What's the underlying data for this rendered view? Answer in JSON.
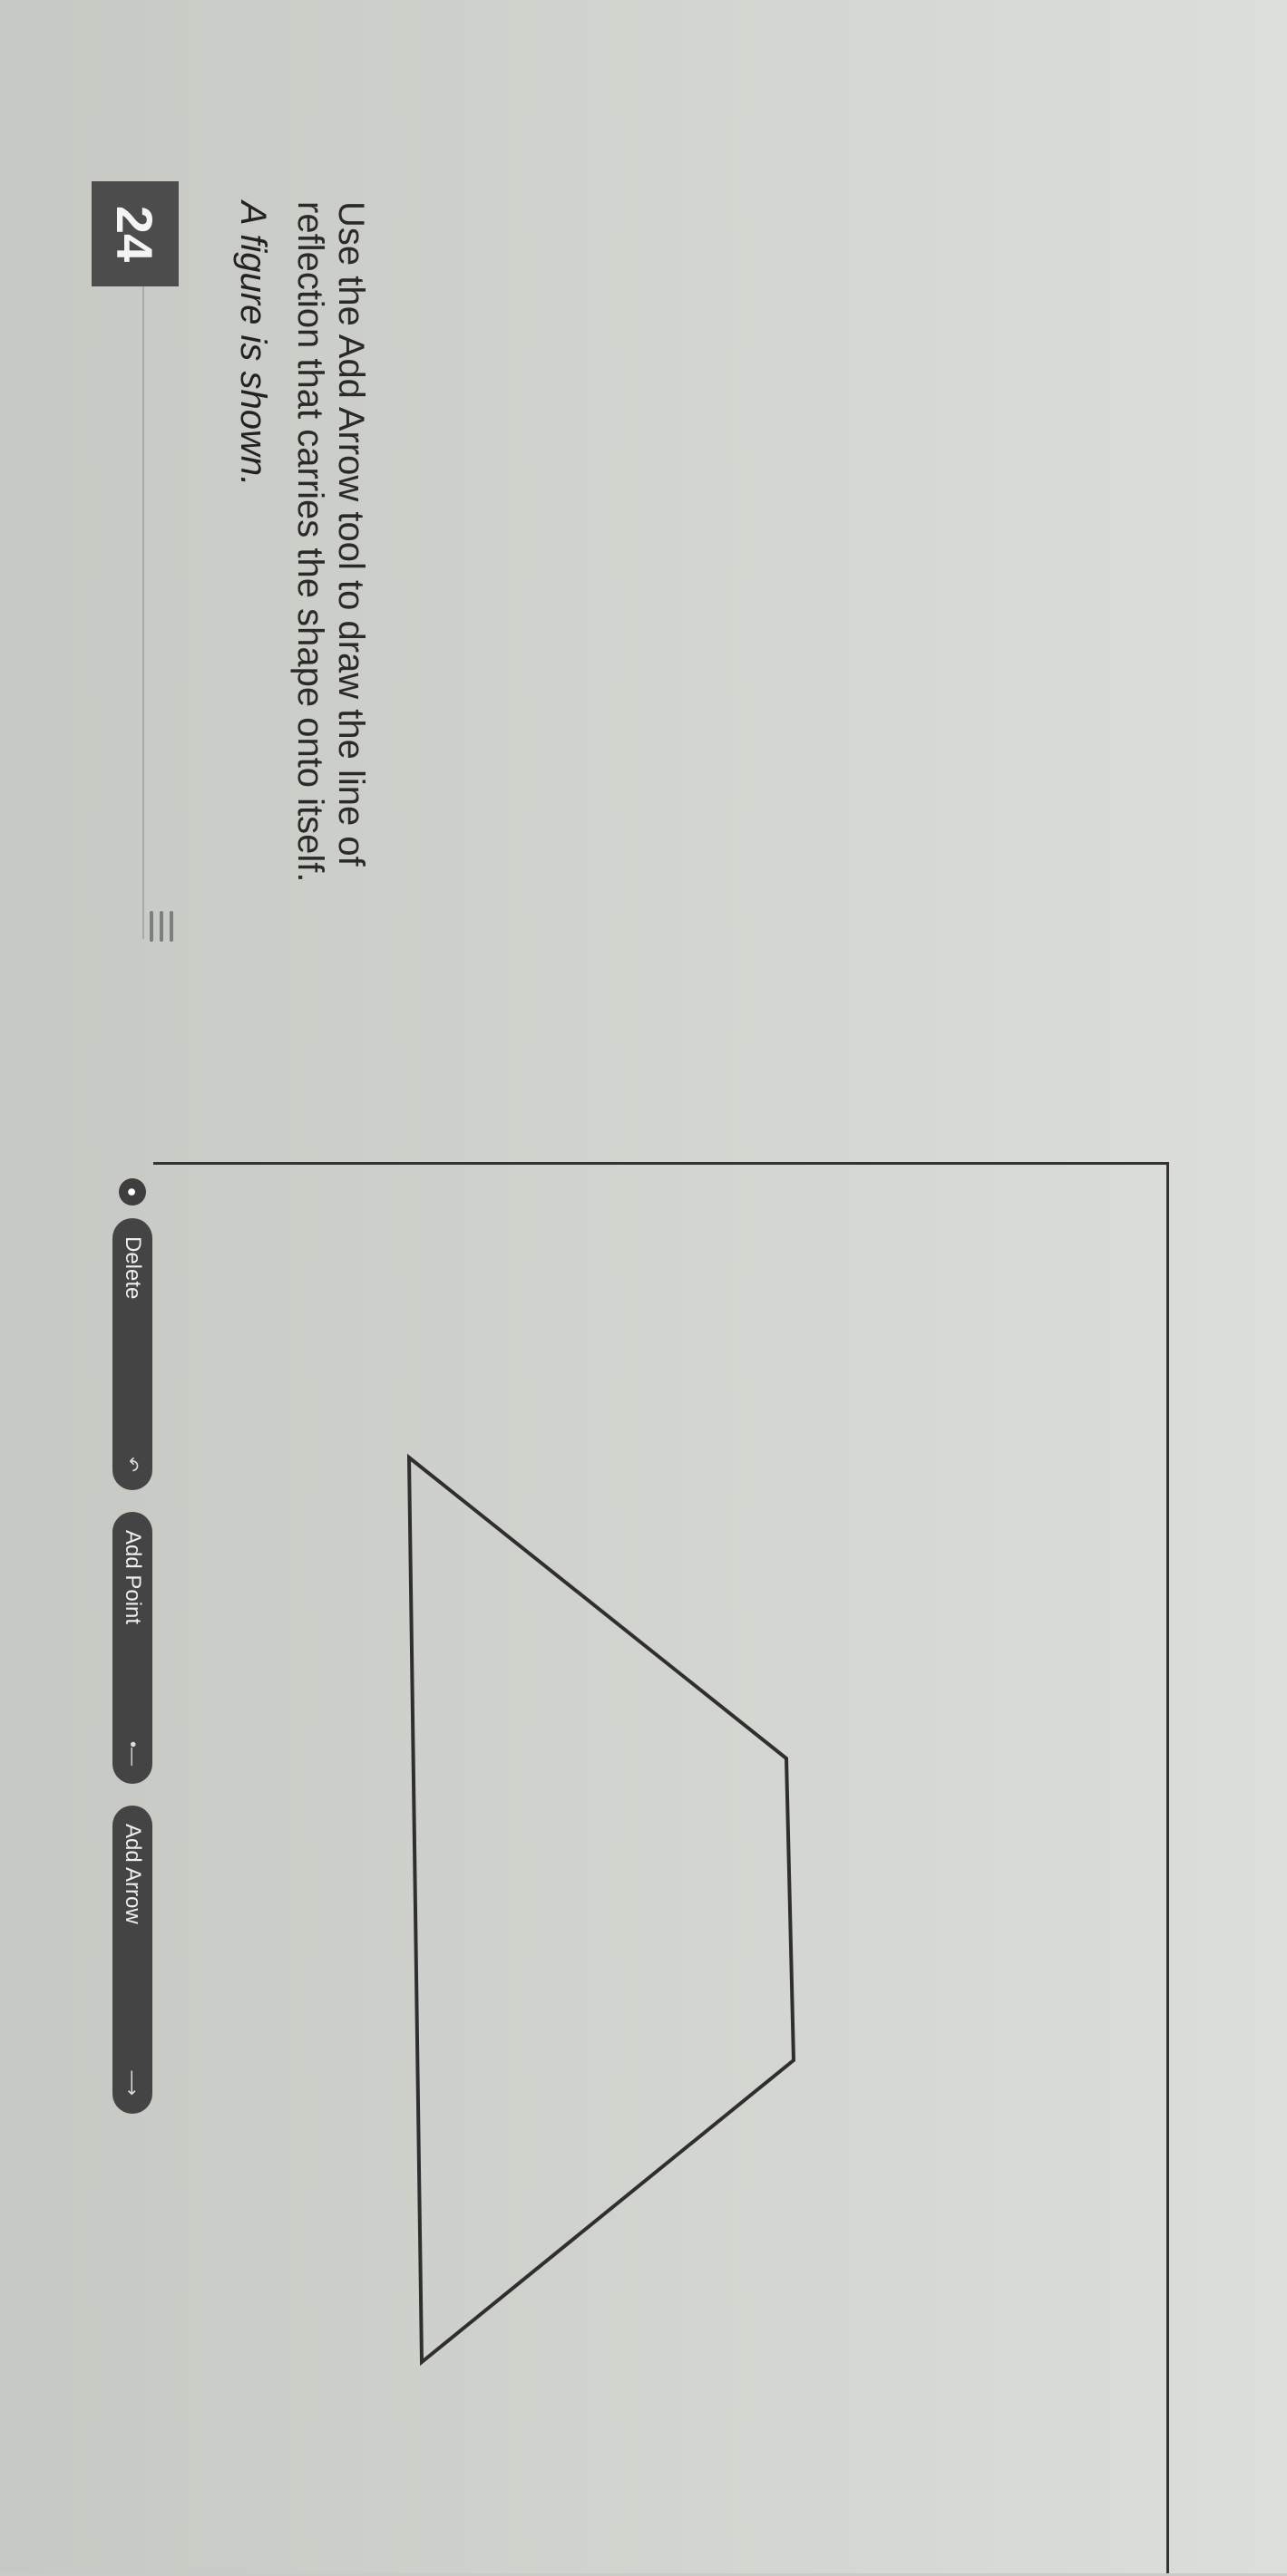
{
  "question": {
    "number": "24",
    "prompt": "A figure is shown.",
    "instructions": "Use the Add Arrow tool to draw the line of reflection that carries the shape onto itself."
  },
  "toolbar": {
    "delete_label": "Delete",
    "add_point_label": "Add Point",
    "add_arrow_label": "Add Arrow"
  },
  "icons": {
    "circle": "circle-icon",
    "delete": "undo-icon",
    "add_point": "point-icon",
    "add_arrow": "arrow-icon",
    "drag": "drag-handle-icon"
  },
  "figure": {
    "shape": "trapezoid",
    "stroke_color": "#2f2f2f"
  }
}
